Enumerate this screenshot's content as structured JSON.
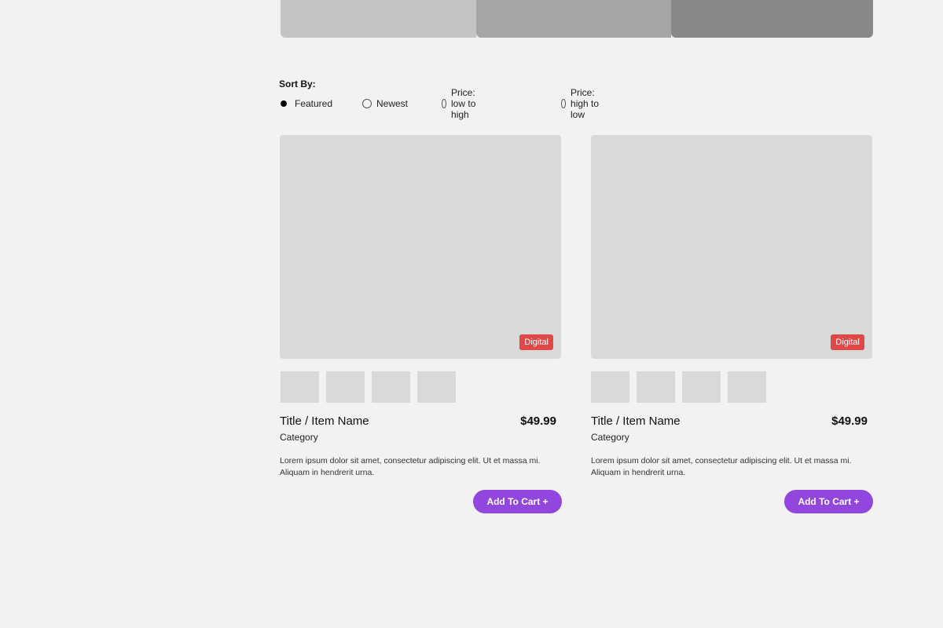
{
  "sort": {
    "title": "Sort By:",
    "options": [
      {
        "label": "Featured",
        "selected": true
      },
      {
        "label": "Newest",
        "selected": false
      },
      {
        "label": "Price: low to high",
        "selected": false
      },
      {
        "label": "Price: high to low",
        "selected": false
      }
    ]
  },
  "products": [
    {
      "badge": "Digital",
      "title": "Title / Item Name",
      "price": "$49.99",
      "category": "Category",
      "description": "Lorem ipsum dolor sit amet, consectetur adipiscing elit. Ut et massa mi. Aliquam in hendrerit urna.",
      "cart_label": "Add To Cart +"
    },
    {
      "badge": "Digital",
      "title": "Title / Item Name",
      "price": "$49.99",
      "category": "Category",
      "description": "Lorem ipsum dolor sit amet, consectetur adipiscing elit. Ut et massa mi. Aliquam in hendrerit urna.",
      "cart_label": "Add To Cart +"
    }
  ],
  "colors": {
    "accent": "#9146de",
    "badge": "#e04848",
    "placeholder": "#d9d9d9",
    "background": "#f2f2f2"
  }
}
